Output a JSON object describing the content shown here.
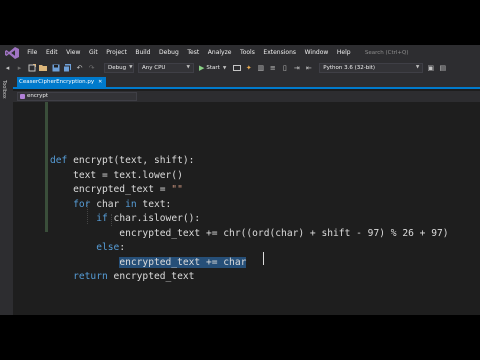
{
  "menu": {
    "items": [
      "File",
      "Edit",
      "View",
      "Git",
      "Project",
      "Build",
      "Debug",
      "Test",
      "Analyze",
      "Tools",
      "Extensions",
      "Window",
      "Help"
    ],
    "search_placeholder": "Search (Ctrl+Q)"
  },
  "toolbar": {
    "config": "Debug",
    "platform": "Any CPU",
    "start_label": "Start",
    "environment": "Python 3.6 (32-bit)"
  },
  "sidebar": {
    "label": "Toolbox"
  },
  "tabs": [
    {
      "label": "CeaserCipherEncryption.py",
      "active": true
    }
  ],
  "navbar": {
    "scope": "encrypt"
  },
  "code": {
    "lines": [
      [
        {
          "t": "def",
          "c": "kw"
        },
        {
          "t": " encrypt(text, shift):"
        }
      ],
      [
        {
          "t": "    text = text.lower()"
        }
      ],
      [
        {
          "t": "    encrypted_text = "
        },
        {
          "t": "\"\"",
          "c": "str"
        }
      ],
      [
        {
          "t": "    "
        },
        {
          "t": "for",
          "c": "kw"
        },
        {
          "t": " char "
        },
        {
          "t": "in",
          "c": "kw"
        },
        {
          "t": " text:"
        }
      ],
      [
        {
          "t": "        "
        },
        {
          "t": "if",
          "c": "kw"
        },
        {
          "t": " char.islower():"
        }
      ],
      [
        {
          "t": "            encrypted_text += chr((ord(char) + shift - 97) % 26 + 97)"
        }
      ],
      [
        {
          "t": "        "
        },
        {
          "t": "else",
          "c": "kw"
        },
        {
          "t": ":"
        }
      ],
      [
        {
          "t": "            "
        },
        {
          "t": "encrypted_text += char",
          "c": "sel"
        }
      ],
      [
        {
          "t": "    "
        },
        {
          "t": "return",
          "c": "kw"
        },
        {
          "t": " encrypted_text"
        }
      ]
    ]
  },
  "colors": {
    "accent": "#007acc",
    "keyword": "#569cd6",
    "string": "#d69d85",
    "selection": "#264f78",
    "editor_bg": "#1e1e1e",
    "chrome_bg": "#2d2d30"
  }
}
